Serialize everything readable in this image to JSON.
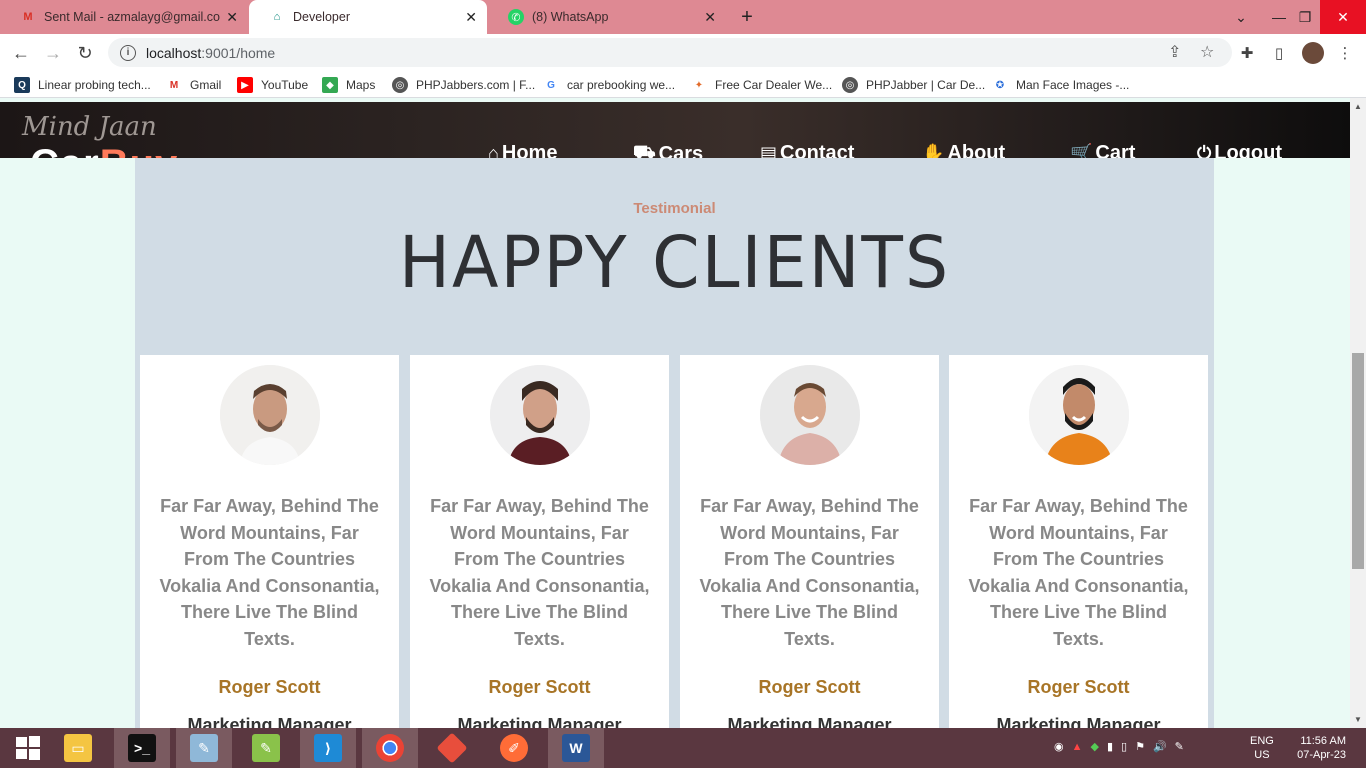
{
  "browser": {
    "tabs": [
      {
        "title": "Sent Mail - azmalayg@gmail.com",
        "icon": "gmail-icon"
      },
      {
        "title": "Developer",
        "icon": "developer-icon"
      },
      {
        "title": "(8) WhatsApp",
        "icon": "whatsapp-icon"
      }
    ],
    "url_host": "localhost",
    "url_rest": ":9001/home",
    "bookmarks": [
      "Linear probing tech...",
      "Gmail",
      "YouTube",
      "Maps",
      "PHPJabbers.com | F...",
      "car prebooking we...",
      "Free Car Dealer We...",
      "PHPJabber | Car De...",
      "Man Face Images -..."
    ]
  },
  "site": {
    "signature": "Mind Jaan",
    "brand_a": "Car",
    "brand_b": "Buy",
    "nav": [
      "Home",
      "Cars",
      "Contact",
      "About",
      "Cart",
      "Logout"
    ]
  },
  "section": {
    "eyebrow": "Testimonial",
    "heading": "HAPPY CLIENTS",
    "cards": [
      {
        "quote": "Far Far Away, Behind The Word Mountains, Far From The Countries Vokalia And Consonantia, There Live The Blind Texts.",
        "name": "Roger Scott",
        "role": "Marketing Manager"
      },
      {
        "quote": "Far Far Away, Behind The Word Mountains, Far From The Countries Vokalia And Consonantia, There Live The Blind Texts.",
        "name": "Roger Scott",
        "role": "Marketing Manager"
      },
      {
        "quote": "Far Far Away, Behind The Word Mountains, Far From The Countries Vokalia And Consonantia, There Live The Blind Texts.",
        "name": "Roger Scott",
        "role": "Marketing Manager"
      },
      {
        "quote": "Far Far Away, Behind The Word Mountains, Far From The Countries Vokalia And Consonantia, There Live The Blind Texts.",
        "name": "Roger Scott",
        "role": "Marketing Manager"
      }
    ]
  },
  "taskbar": {
    "lang_1": "ENG",
    "lang_2": "US",
    "time": "11:56 AM",
    "date": "07-Apr-23"
  },
  "colors": {
    "tab_strip": "#de8993",
    "section_bg": "#d1dce5",
    "eyebrow": "#cc8a75",
    "client_name": "#a87527",
    "taskbar": "#5a3740"
  }
}
